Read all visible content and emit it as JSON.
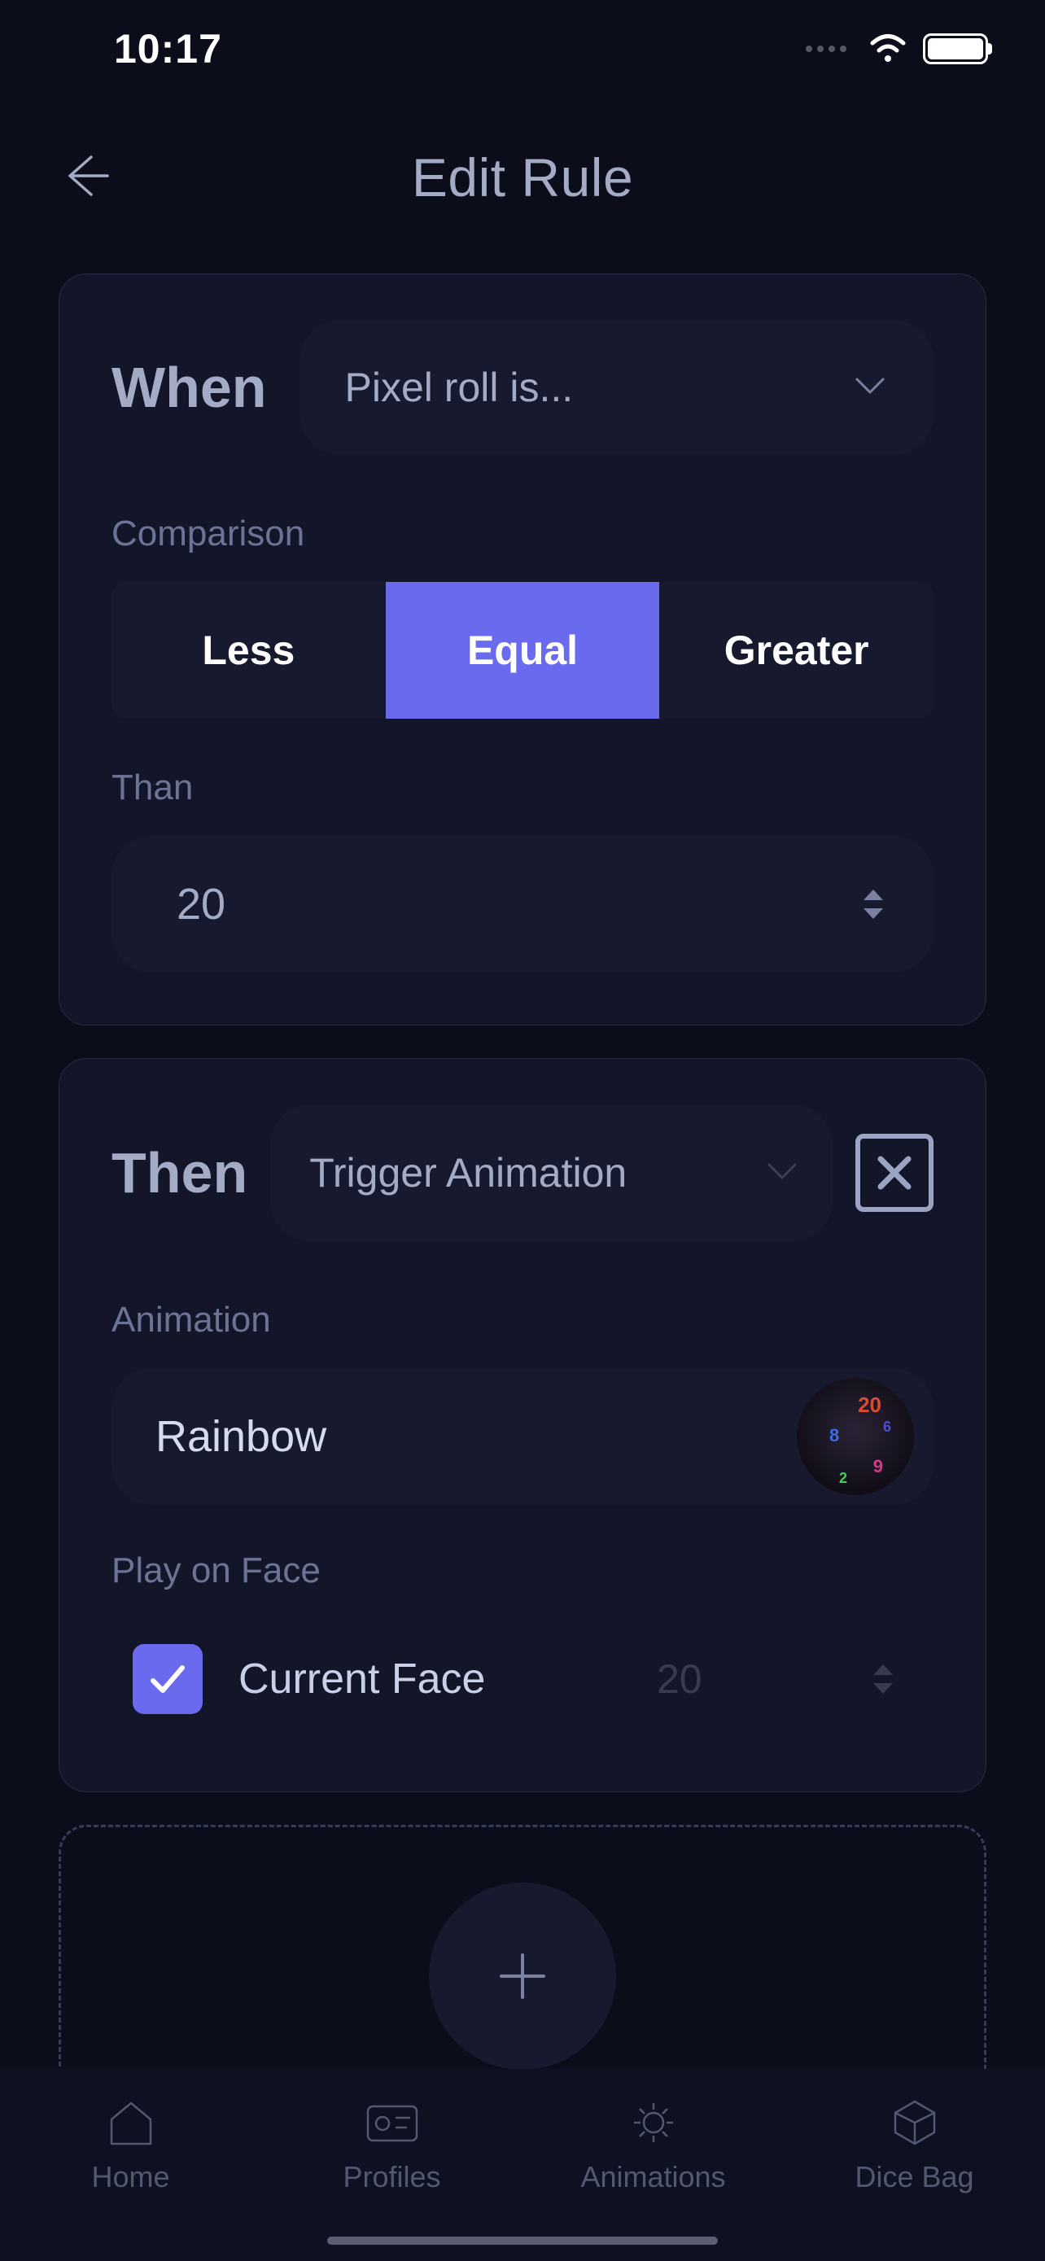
{
  "status": {
    "time": "10:17"
  },
  "header": {
    "title": "Edit Rule"
  },
  "when": {
    "section_label": "When",
    "trigger_selected": "Pixel roll is...",
    "comparison_label": "Comparison",
    "comparison_options": {
      "less": "Less",
      "equal": "Equal",
      "greater": "Greater"
    },
    "comparison_selected": "Equal",
    "than_label": "Than",
    "than_value": "20"
  },
  "then": {
    "section_label": "Then",
    "action_selected": "Trigger Animation",
    "animation_label": "Animation",
    "animation_selected": "Rainbow",
    "play_on_face_label": "Play on Face",
    "current_face_label": "Current Face",
    "current_face_checked": true,
    "face_value": "20"
  },
  "tabs": {
    "home": "Home",
    "profiles": "Profiles",
    "animations": "Animations",
    "dicebag": "Dice Bag"
  }
}
